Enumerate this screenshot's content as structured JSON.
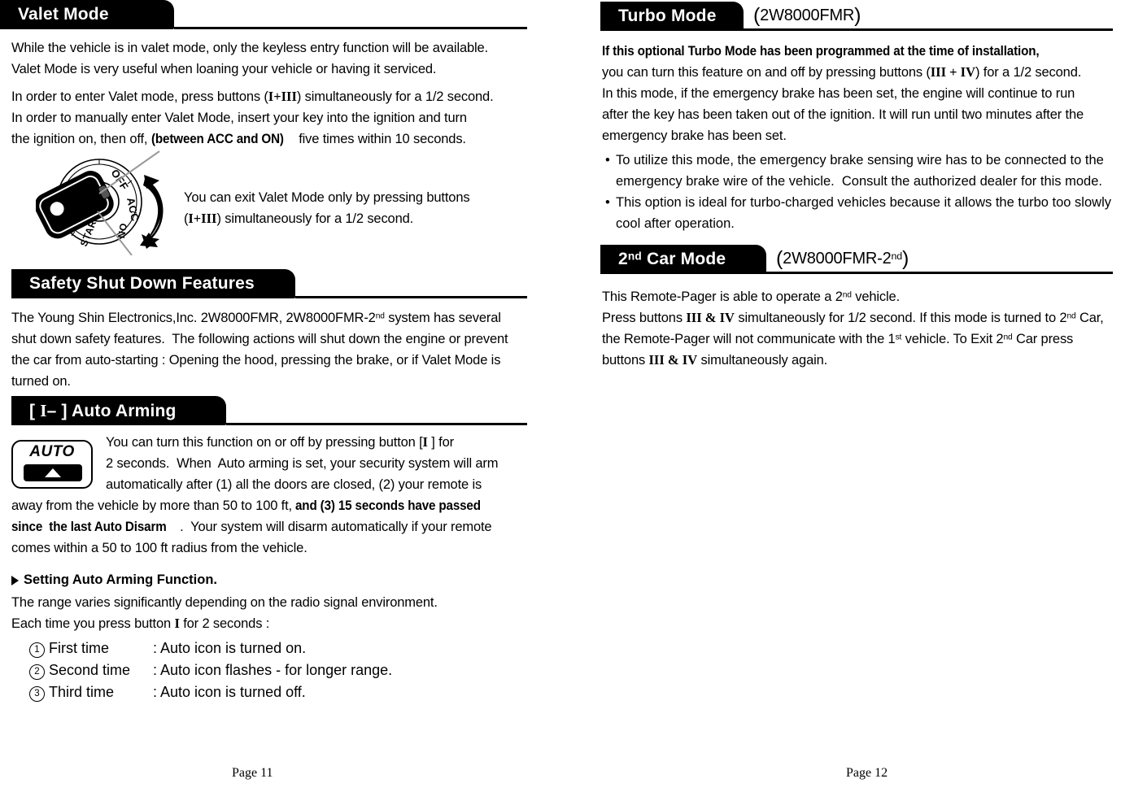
{
  "document": {
    "left_page": {
      "number_label": "Page 11"
    },
    "right_page": {
      "number_label": "Page 12"
    }
  },
  "valet": {
    "heading": "Valet Mode",
    "para1": "While the vehicle is in valet mode, only the keyless entry function will be available.\nValet Mode is very useful when loaning your vehicle or having it serviced.",
    "para2_a": "In order to enter Valet mode, press buttons (",
    "para2_buttons": "I+III",
    "para2_b": ") simultaneously for a 1/2 second.\nIn order to manually enter Valet Mode, insert your key into the ignition and turn\nthe ignition on, then off, ",
    "para2_bold": "(between ACC and ON)",
    "para2_c": " five times within 10 seconds.",
    "note_a": "You can exit Valet Mode only by pressing buttons\n(",
    "note_buttons": "I+III",
    "note_b": ") simultaneously for a 1/2 second.",
    "ignition_labels": {
      "off": "OFF",
      "acc": "ACC",
      "on": "ON",
      "start": "START"
    }
  },
  "safety": {
    "heading": "Safety Shut Down Features",
    "para_a": "The Young Shin Electronics,Inc. 2W8000FMR, 2W8000FMR-2",
    "para_sup": "nd",
    "para_b": " system has several\nshut down safety features.  The following actions will shut down the engine or prevent\nthe car from auto-starting : Opening the hood, pressing the brake, or if Valet Mode is\nturned on."
  },
  "auto_arming": {
    "heading_pre": "[ ",
    "heading_roman": "I",
    "heading_dash": "–",
    "heading_post": " ] Auto Arming",
    "icon_label": "AUTO",
    "para_a": "You can turn this function on or off by pressing button [",
    "para_roman": "I",
    "para_b": " ] for\n2 seconds.  When  Auto arming is set, your security system will arm\nautomatically after (1) all the doors are closed, (2) your remote is",
    "para_c": "away from the vehicle by more than 50 to 100 ft, ",
    "para_bold1": "and (3) 15 seconds have passed",
    "para_bold2": "since  the last Auto Disarm",
    "para_d": ".  Your system will disarm automatically if your remote\ncomes within a 50 to 100 ft radius from the vehicle.",
    "setting_heading": "Setting Auto Arming Function.",
    "setting_line1": "The range varies significantly depending on the radio signal environment.",
    "setting_line2_a": "Each time you press button ",
    "setting_line2_roman": "I",
    "setting_line2_b": " for 2 seconds :",
    "steps": [
      {
        "num": "1",
        "what": "First time",
        "result": ": Auto icon is turned on."
      },
      {
        "num": "2",
        "what": "Second time",
        "result": ": Auto icon flashes - for longer range."
      },
      {
        "num": "3",
        "what": "Third time",
        "result": ": Auto icon is turned off."
      }
    ]
  },
  "turbo": {
    "heading": "Turbo Mode",
    "model": "2W8000FMR",
    "para_bold": "If this optional Turbo Mode has been programmed at the time of installation,",
    "para_a": "you can turn this feature on and off by pressing buttons (",
    "para_buttons": "III + IV",
    "para_b": ") for a 1/2 second.\nIn this mode, if the emergency brake has been set, the engine will continue to run\nafter the key has been taken out of the ignition. It will run until two minutes after the\nemergency brake has been set.",
    "bullets": [
      "To utilize this mode, the emergency brake sensing wire has to be connected to the\nemergency brake wire of the vehicle.  Consult the authorized dealer for this mode.",
      "This option is ideal for turbo-charged vehicles because it allows the turbo too slowly\ncool after operation."
    ]
  },
  "second_car": {
    "heading_num": "2",
    "heading_sup": "nd",
    "heading_rest": " Car Mode",
    "model_pre": "2W8000FMR-2",
    "model_sup": "nd",
    "para_a": "This Remote-Pager is able to operate a 2",
    "para_sup1": "nd",
    "para_b": " vehicle.\nPress buttons ",
    "para_buttons1": "III & IV",
    "para_c": " simultaneously for 1/2 second. If this mode is turned to 2",
    "para_sup2": "nd",
    "para_d": " Car,\nthe Remote-Pager will not communicate with the 1",
    "para_sup3": "st",
    "para_e": " vehicle. To Exit 2",
    "para_sup4": "nd",
    "para_f": " Car press\nbuttons ",
    "para_buttons2": "III & IV",
    "para_g": " simultaneously again."
  },
  "colors": {
    "ink": "#000000",
    "paper": "#ffffff"
  }
}
